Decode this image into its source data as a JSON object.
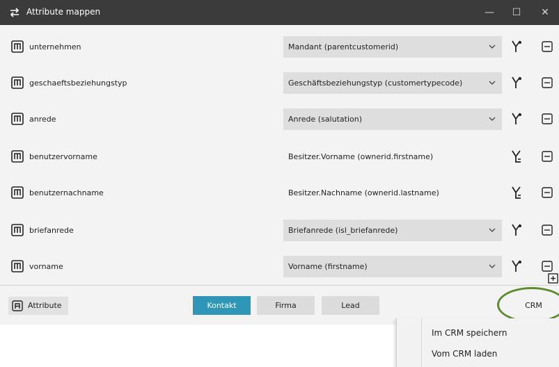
{
  "window": {
    "title": "Attribute mappen",
    "minimize": "—",
    "maximize": "☐",
    "close": "✕"
  },
  "rows": [
    {
      "name": "unternehmen",
      "value": "Mandant (parentcustomerid)",
      "type": "dropdown"
    },
    {
      "name": "geschaeftsbeziehungstyp",
      "value": "Geschäftsbeziehungstyp (customertypecode)",
      "type": "dropdown"
    },
    {
      "name": "anrede",
      "value": "Anrede (salutation)",
      "type": "dropdown"
    },
    {
      "name": "benutzervorname",
      "value": "Besitzer.Vorname (ownerid.firstname)",
      "type": "static"
    },
    {
      "name": "benutzernachname",
      "value": "Besitzer.Nachname (ownerid.lastname)",
      "type": "static"
    },
    {
      "name": "briefanrede",
      "value": "Briefanrede (isl_briefanrede)",
      "type": "dropdown"
    },
    {
      "name": "vorname",
      "value": "Vorname (firstname)",
      "type": "dropdown"
    }
  ],
  "footer": {
    "attribute_label": "Attribute",
    "tabs": [
      {
        "label": "Kontakt",
        "active": true
      },
      {
        "label": "Firma",
        "active": false
      },
      {
        "label": "Lead",
        "active": false
      }
    ],
    "crm_label": "CRM"
  },
  "menu": {
    "items": [
      "Im CRM speichern",
      "Vom CRM laden"
    ]
  },
  "colors": {
    "titlebar": "#3b3b3b",
    "active_tab": "#2e97b8",
    "highlight_circle": "#5d8a2e"
  },
  "icons": {
    "app": "swap-arrows-icon",
    "row": "m-box-icon",
    "fork": "branch-fork-icon",
    "remove": "minus-box-icon",
    "add": "plus-box-icon",
    "attribute": "a-box-icon"
  }
}
